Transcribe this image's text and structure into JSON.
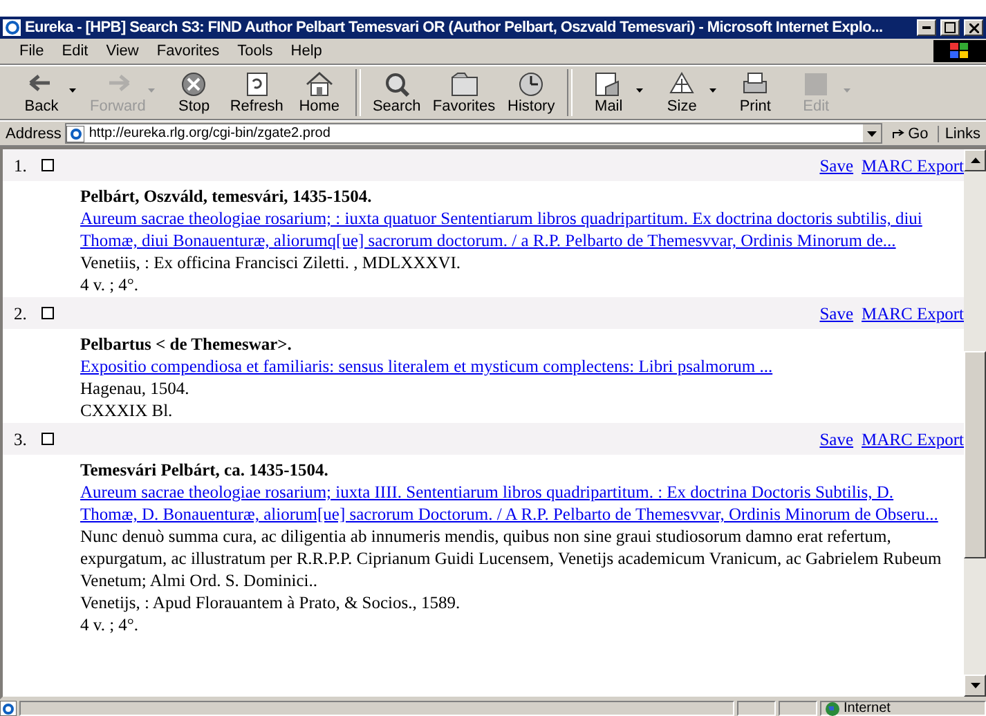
{
  "window": {
    "title": "Eureka - [HPB] Search S3: FIND Author Pelbart Temesvari OR (Author Pelbart, Oszvald Temesvari)  - Microsoft Internet Explo..."
  },
  "menu": [
    "File",
    "Edit",
    "View",
    "Favorites",
    "Tools",
    "Help"
  ],
  "toolbar": [
    {
      "kind": "back",
      "label": "Back",
      "disabled": false,
      "dropdown": true
    },
    {
      "kind": "forward",
      "label": "Forward",
      "disabled": true,
      "dropdown": true
    },
    {
      "kind": "stop",
      "label": "Stop",
      "disabled": false,
      "dropdown": false
    },
    {
      "kind": "refresh",
      "label": "Refresh",
      "disabled": false,
      "dropdown": false
    },
    {
      "kind": "home",
      "label": "Home",
      "disabled": false,
      "dropdown": false,
      "group_end": true
    },
    {
      "kind": "search",
      "label": "Search",
      "disabled": false,
      "dropdown": false
    },
    {
      "kind": "favorites",
      "label": "Favorites",
      "disabled": false,
      "dropdown": false
    },
    {
      "kind": "history",
      "label": "History",
      "disabled": false,
      "dropdown": false,
      "group_end": true
    },
    {
      "kind": "mail",
      "label": "Mail",
      "disabled": false,
      "dropdown": true
    },
    {
      "kind": "size",
      "label": "Size",
      "disabled": false,
      "dropdown": true
    },
    {
      "kind": "print",
      "label": "Print",
      "disabled": false,
      "dropdown": false
    },
    {
      "kind": "edit",
      "label": "Edit",
      "disabled": true,
      "dropdown": true
    }
  ],
  "address": {
    "label": "Address",
    "url": "http://eureka.rlg.org/cgi-bin/zgate2.prod",
    "go": "Go",
    "links": "Links"
  },
  "records": [
    {
      "number": "1.",
      "checked": false,
      "actions": [
        "Save",
        "MARC Export"
      ],
      "heading": "Pelbárt, Oszváld, temesvári, 1435-1504.",
      "title": "Aureum sacrae theologiae rosarium; : iuxta quatuor Sententiarum libros quadripartitum. Ex doctrina doctoris subtilis, diui Thomæ, diui Bonauenturæ, aliorumq[ue] sacrorum doctorum. / a R.P. Pelbarto de Themesvvar, Ordinis Minorum de...",
      "lines": [
        "Venetiis, : Ex officina Francisci Ziletti. , MDLXXXVI.",
        "4 v. ; 4°."
      ]
    },
    {
      "number": "2.",
      "checked": false,
      "actions": [
        "Save",
        "MARC Export"
      ],
      "heading": "Pelbartus < de Themeswar>.",
      "title": "Expositio compendiosa et familiaris: sensus literalem et mysticum complectens: Libri psalmorum ...",
      "lines": [
        "Hagenau, 1504.",
        "CXXXIX Bl."
      ]
    },
    {
      "number": "3.",
      "checked": false,
      "actions": [
        "Save",
        "MARC Export"
      ],
      "heading": "Temesvári Pelbárt, ca. 1435-1504.",
      "title": "Aureum sacrae theologiae rosarium; iuxta IIII. Sententiarum libros quadripartitum. : Ex doctrina Doctoris Subtilis, D. Thomæ, D. Bonauenturæ, aliorum[ue] sacrorum Doctorum. / A R.P. Pelbarto de Themesvvar, Ordinis Minorum de Obseru...",
      "note": "Nunc denuò summa cura, ac diligentia ab innumeris mendis, quibus non sine graui studiosorum damno erat refertum, expurgatum, ac illustratum per R.R.P.P. Ciprianum Guidi Lucensem, Venetijs academicum Vranicum, ac Gabrielem Rubeum Venetum; Almi Ord. S. Dominici..",
      "lines": [
        "Venetijs, : Apud Florauantem à Prato, & Socios., 1589.",
        "4 v. ; 4°."
      ]
    }
  ],
  "status_bar": {
    "zone": "Internet"
  }
}
